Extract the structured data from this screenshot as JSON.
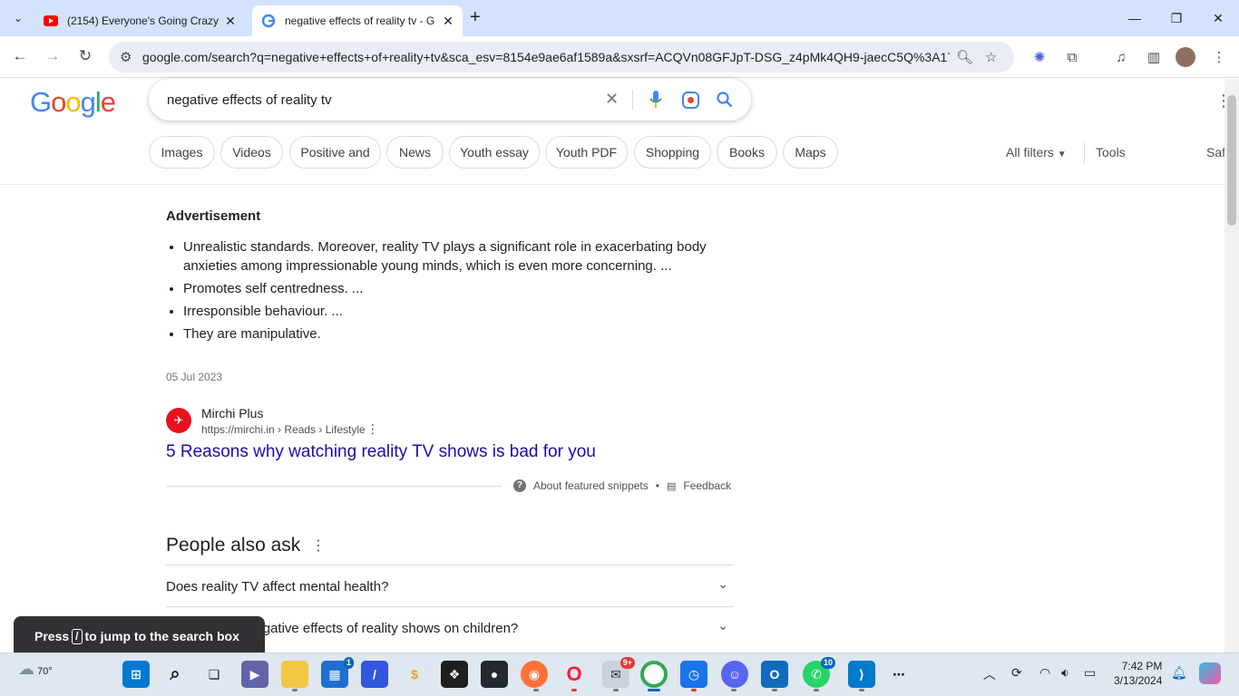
{
  "browser": {
    "tabs": [
      {
        "title": "(2154) Everyone's Going Crazy A",
        "close": "✕"
      },
      {
        "title": "negative effects of reality tv - G",
        "close": "✕"
      }
    ],
    "url": "google.com/search?q=negative+effects+of+reality+tv&sca_esv=8154e9ae6af1589a&sxsrf=ACQVn08GFJpT-DSG_z4pMk4QH9-jaecC5Q%3A17..."
  },
  "google": {
    "logo": "Google",
    "query": "negative effects of reality tv",
    "chips": [
      "Images",
      "Videos",
      "Positive and",
      "News",
      "Youth essay",
      "Youth PDF",
      "Shopping",
      "Books",
      "Maps"
    ],
    "all_filters": "All filters",
    "tools": "Tools",
    "safesearch_partial": "Saf"
  },
  "snippet": {
    "heading": "Advertisement",
    "bullets": [
      "Unrealistic standards. Moreover, reality TV plays a significant role in exacerbating body anxieties among impressionable young minds, which is even more concerning. ...",
      "Promotes self centredness. ...",
      "Irresponsible behaviour. ...",
      "They are manipulative."
    ],
    "date": "05 Jul 2023",
    "source_name": "Mirchi Plus",
    "source_url": "https://mirchi.in › Reads › Lifestyle",
    "link_title": "5 Reasons why watching reality TV shows is bad for you",
    "about": "About featured snippets",
    "separator": "•",
    "feedback": "Feedback"
  },
  "paa": {
    "title": "People also ask",
    "questions": [
      "Does reality TV affect mental health?",
      "What are the negative effects of reality shows on children?"
    ]
  },
  "toast": {
    "press": "Press",
    "key": "/",
    "rest": "to jump to the search box"
  },
  "taskbar": {
    "weather": "70°",
    "badges": {
      "store": "1",
      "app9": "9+",
      "whatsapp": "10"
    },
    "time": "7:42 PM",
    "date": "3/13/2024"
  }
}
